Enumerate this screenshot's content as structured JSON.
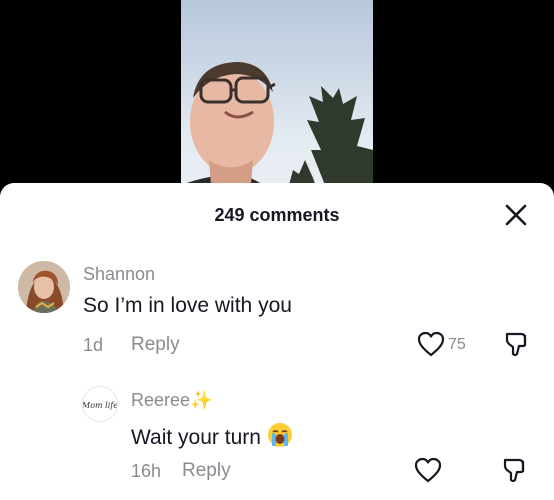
{
  "video": {
    "description_icon": "person-face-video"
  },
  "sheet": {
    "title": "249 comments",
    "close_icon": "close-icon"
  },
  "comments": [
    {
      "username": "Shannon",
      "text": "So I’m in love with you",
      "age": "1d",
      "reply_label": "Reply",
      "likes": "75"
    }
  ],
  "replies": [
    {
      "username": "Reeree",
      "username_suffix": "✨",
      "text": "Wait your turn",
      "emoji_icon": "loudly-crying-face-icon",
      "age": "16h",
      "reply_label": "Reply",
      "avatar_lettering": "Mom life"
    }
  ],
  "colors": {
    "text": "#161823",
    "muted": "#8a8b91",
    "sparkle": "#f5c22b"
  }
}
